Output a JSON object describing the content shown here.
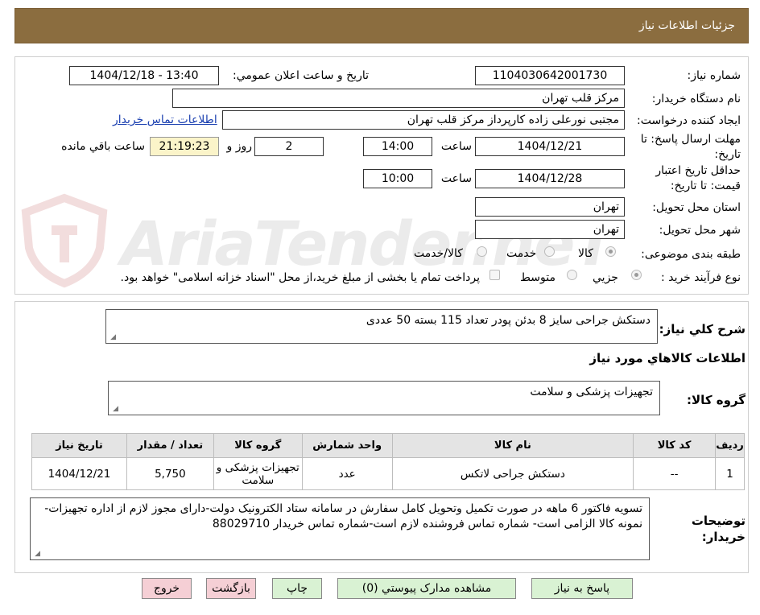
{
  "header": {
    "title": "جزئيات اطلاعات نياز"
  },
  "watermark": {
    "text": "AriaTender.neT"
  },
  "form": {
    "need_number_label": "شماره نياز:",
    "need_number": "1104030642001730",
    "announce_label": "تاريخ و ساعت اعلان عمومي:",
    "announce_value": "1404/12/18 - 13:40",
    "buyer_org_label": "نام دستگاه خريدار:",
    "buyer_org": "مرکز قلب تهران",
    "requester_label": "ايجاد کننده درخواست:",
    "requester": "مجتبی نورعلی زاده کارپرداز مرکز قلب تهران",
    "contact_link": "اطلاعات تماس خريدار",
    "deadline_label_1": "مهلت ارسال پاسخ: تا",
    "deadline_label_2": "تاريخ:",
    "deadline_date": "1404/12/21",
    "time_label": "ساعت",
    "deadline_time": "14:00",
    "days_value": "2",
    "days_label": "روز و",
    "remaining_time": "21:19:23",
    "remaining_label": "ساعت باقي مانده",
    "validity_label_1": "حداقل تاريخ اعتبار",
    "validity_label_2": "قيمت: تا تاريخ:",
    "validity_date": "1404/12/28",
    "validity_time_label": "ساعت",
    "validity_time": "10:00",
    "province_label": "استان محل تحويل:",
    "province": "تهران",
    "city_label": "شهر محل تحويل:",
    "city": "تهران",
    "category_label": "طبقه بندی موضوعی:",
    "category_options": [
      "کالا",
      "خدمت",
      "کالا/خدمت"
    ],
    "process_label": "نوع فرآيند خريد :",
    "process_options": [
      "جزيي",
      "متوسط"
    ],
    "payment_note": "پرداخت تمام يا بخشی از مبلغ خريد،از محل \"اسناد خزانه اسلامی\" خواهد بود."
  },
  "details": {
    "summary_label": "شرح کلي نياز:",
    "summary_text": "دستکش جراحی سایز 8 بدئن پودر تعداد 115 بسته 50 عددی",
    "goods_info_title": "اطلاعات کالاهاي مورد نياز",
    "goods_group_label": "گروه کالا:",
    "goods_group_value": "تجهيزات پزشکی و سلامت",
    "table": {
      "headers": [
        "رديف",
        "کد کالا",
        "نام کالا",
        "واحد شمارش",
        "گروه کالا",
        "تعداد / مقدار",
        "تاريخ نياز"
      ],
      "rows": [
        [
          "1",
          "--",
          "دستکش جراحی لاتکس",
          "عدد",
          "تجهيزات پزشکی و سلامت",
          "5,750",
          "1404/12/21"
        ]
      ]
    },
    "buyer_notes_label_1": "توضيحات",
    "buyer_notes_label_2": "خريدار:",
    "buyer_notes_text": "تسویه فاکتور 6 ماهه در صورت تکمیل وتحویل کامل سفارش در سامانه  ستاد الکترونیک دولت-دارای مجوز لازم از اداره تجهیزات-نمونه کالا الزامی است- شماره تماس فروشنده لازم است-شماره تماس خریدار 88029710"
  },
  "buttons": {
    "reply": "پاسخ به نياز",
    "attachments": "مشاهده مدارک پيوستي (0)",
    "print": "چاپ",
    "back": "بازگشت",
    "exit": "خروج"
  }
}
